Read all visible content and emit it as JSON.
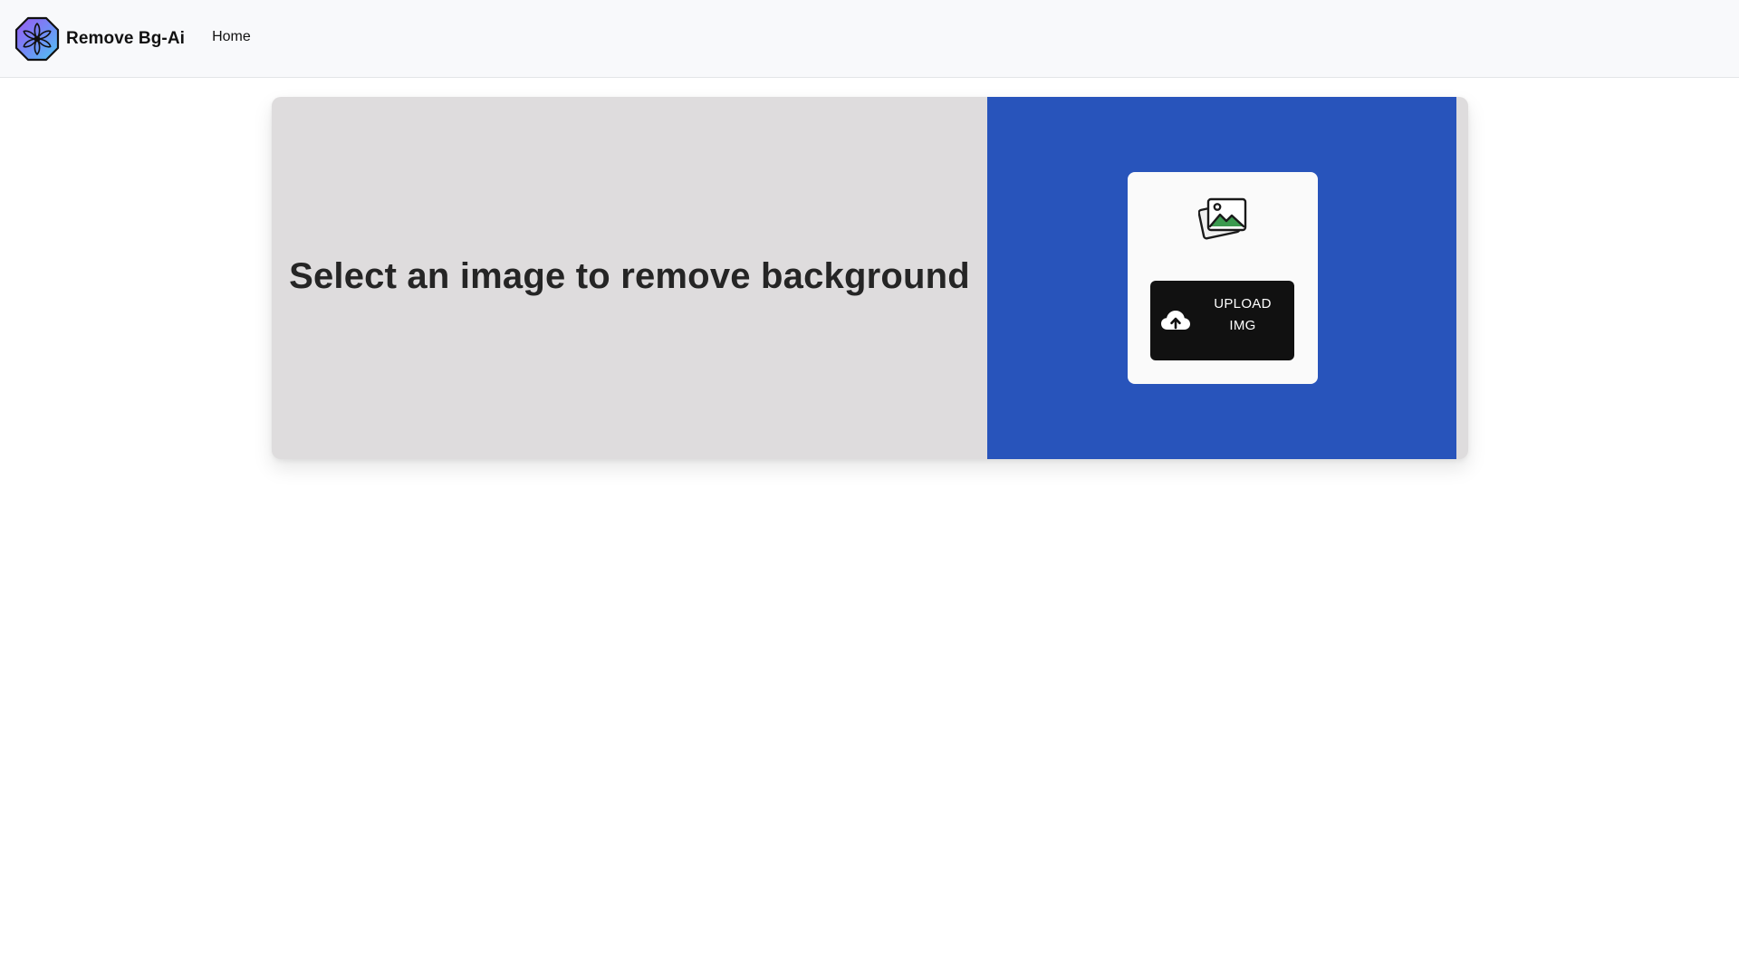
{
  "navbar": {
    "brand_name": "Remove Bg-Ai",
    "links": [
      "Home"
    ]
  },
  "hero": {
    "headline": "Select an image to remove background"
  },
  "uploader": {
    "button_label": "UPLOAD IMG"
  },
  "icons": {
    "brand": "flower-logo-icon",
    "gallery": "image-gallery-icon",
    "upload": "cloud-upload-icon"
  },
  "colors": {
    "navbar_bg": "#f8f9fb",
    "card_bg": "#dedcdd",
    "accent_blue": "#2854bb",
    "button_bg": "#111111",
    "headline": "#252525"
  }
}
